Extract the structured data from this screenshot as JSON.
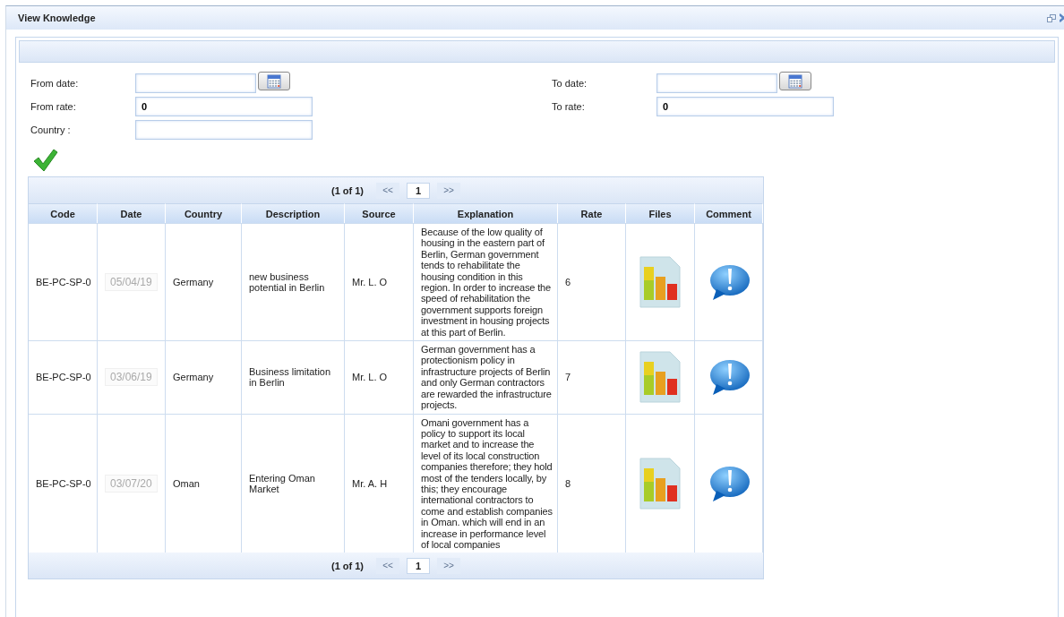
{
  "window": {
    "title": "View Knowledge"
  },
  "filters": {
    "left": [
      {
        "kind": "date",
        "label": "From date:"
      },
      {
        "kind": "text",
        "label": "From rate:",
        "value": "0"
      },
      {
        "kind": "text",
        "label": "Country :"
      }
    ],
    "right": [
      {
        "kind": "date",
        "label": "To date:"
      },
      {
        "kind": "text",
        "label": "To rate:",
        "value": "0"
      }
    ]
  },
  "paginators": [
    {
      "status": "(1 of 1)",
      "first": {
        "label": "<<",
        "disabled": true
      },
      "pages": [
        {
          "label": "1",
          "selected": true
        }
      ],
      "next": {
        "label": ">>",
        "disabled": true
      }
    },
    {
      "status": "(1 of 1)",
      "first": {
        "label": "<<",
        "disabled": true
      },
      "pages": [
        {
          "label": "1",
          "selected": true
        }
      ],
      "next": {
        "label": ">>",
        "disabled": true
      }
    }
  ],
  "table": {
    "columns": [
      "Code",
      "Date",
      "Country",
      "Description",
      "Source",
      "Explanation",
      "Rate",
      "Files",
      "Comment"
    ],
    "rows": [
      {
        "code": "BE-PC-SP-0",
        "date": "05/04/19",
        "country": "Germany",
        "description": "new business potential in Berlin",
        "source": "Mr. L. O",
        "explanation": "Because of the low quality of housing in the eastern part of Berlin, German government tends to rehabilitate the housing condition in this region. In order to increase the speed of rehabilitation the government supports foreign investment in housing projects at this part of Berlin.",
        "rate": "6"
      },
      {
        "code": "BE-PC-SP-0",
        "date": "03/06/19",
        "country": "Germany",
        "description": "Business limitation in Berlin",
        "source": "Mr. L. O",
        "explanation": "German government has a protectionism policy in infrastructure projects of Berlin and only German contractors are rewarded the infrastructure projects.",
        "rate": "7"
      },
      {
        "code": "BE-PC-SP-0",
        "date": "03/07/20",
        "country": "Oman",
        "description": "Entering Oman Market",
        "source": "Mr. A. H",
        "explanation": "Omani government has a policy to support its local market and to increase the level of its local construction companies therefore; they hold most of the tenders locally, by this; they encourage international contractors to come and establish companies in Oman. which will end in an increase in performance level of local companies",
        "rate": "8"
      }
    ]
  }
}
